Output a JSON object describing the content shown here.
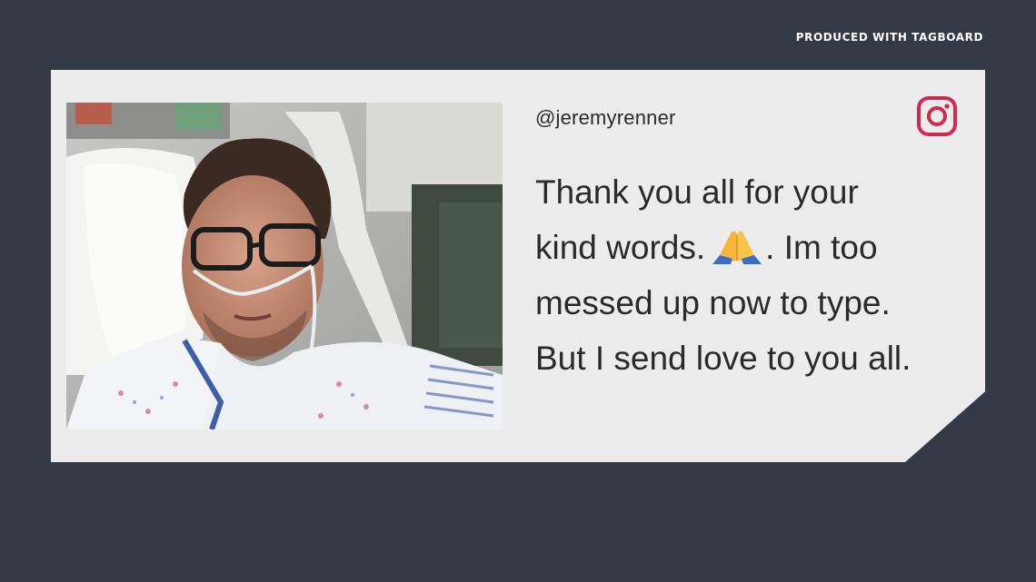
{
  "header": {
    "produced_label": "PRODUCED WITH TAGBOARD"
  },
  "post": {
    "platform_icon": "instagram-icon",
    "handle": "@jeremyrenner",
    "lines": {
      "line1": "Thank you all for your",
      "line2a": "kind words.",
      "line2b": ". Im too",
      "line3": "messed up now to type.",
      "line4": "But I send love to you all."
    },
    "emoji_icon": "folded-hands-icon",
    "photo_icon": "hospital-selfie-photo"
  },
  "colors": {
    "background": "#323a46",
    "card": "#ececec",
    "text": "#2a2a2a",
    "instagram_accent": "#d1294f"
  }
}
